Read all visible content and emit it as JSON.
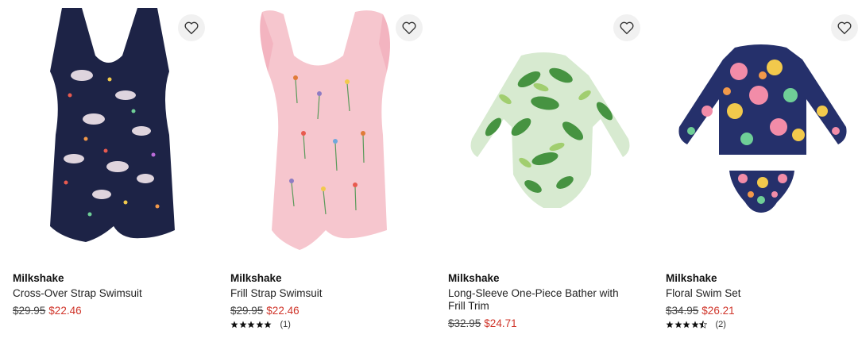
{
  "products": [
    {
      "brand": "Milkshake",
      "title": "Cross-Over Strap Swimsuit",
      "price_was": "$29.95",
      "price_now": "$22.46",
      "rating_count": "",
      "image_icon": "navy-unicorn-swimsuit"
    },
    {
      "brand": "Milkshake",
      "title": "Frill Strap Swimsuit",
      "price_was": "$29.95",
      "price_now": "$22.46",
      "rating_stars": 5,
      "rating_count": "(1)",
      "image_icon": "pink-floral-swimsuit"
    },
    {
      "brand": "Milkshake",
      "title": "Long-Sleeve One-Piece Bather with Frill Trim",
      "price_was": "$32.95",
      "price_now": "$24.71",
      "rating_count": "",
      "image_icon": "green-leaf-longsleeve-swimsuit"
    },
    {
      "brand": "Milkshake",
      "title": "Floral Swim Set",
      "price_was": "$34.95",
      "price_now": "$26.21",
      "rating_stars": 4.5,
      "rating_count": "(2)",
      "image_icon": "floral-swim-set"
    }
  ],
  "colors": {
    "sale_price": "#d0352a",
    "wishlist_bg": "#f1f1f1"
  }
}
